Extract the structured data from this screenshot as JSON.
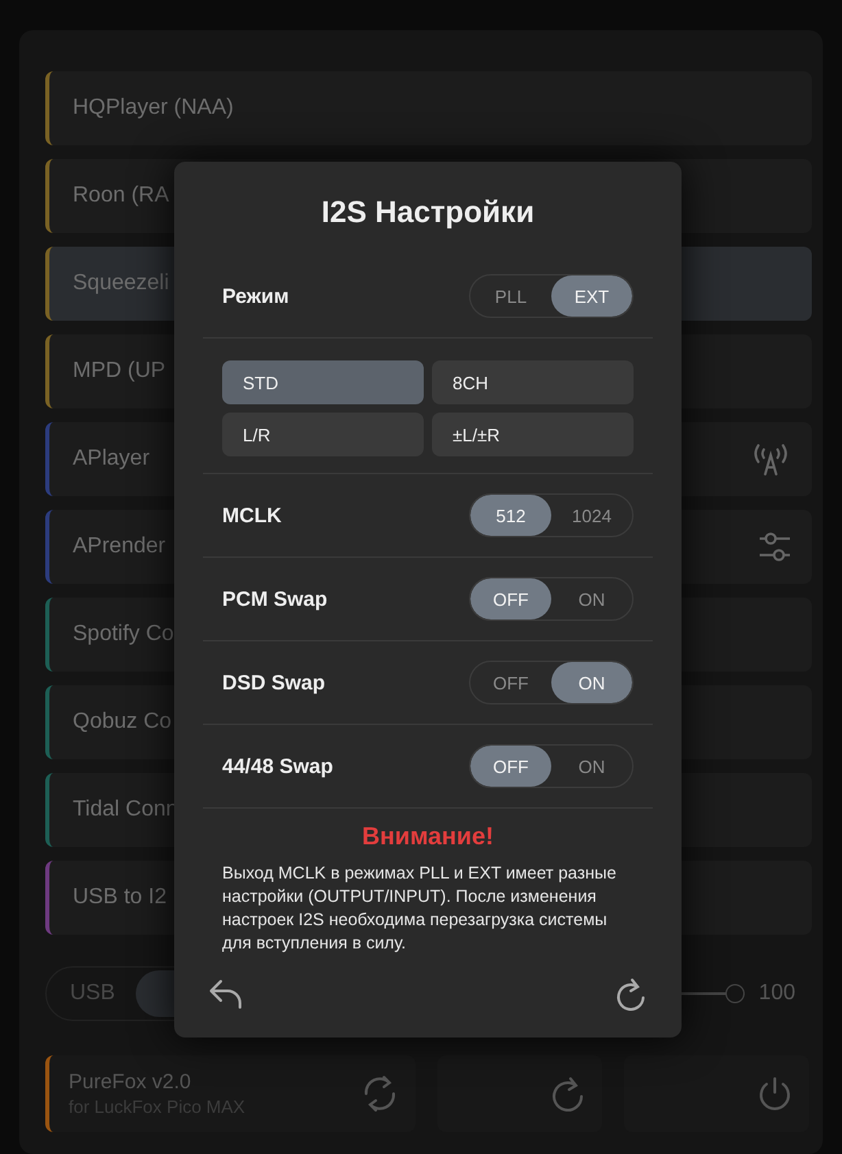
{
  "services": [
    {
      "name": "HQPlayer (NAA)",
      "color": "#7a6224",
      "selected": false,
      "kind": "plain"
    },
    {
      "name": "Roon (RA",
      "color": "#7a6224",
      "selected": false,
      "kind": "plain"
    },
    {
      "name": "Squeezeli",
      "color": "#7a6224",
      "selected": true,
      "kind": "plain"
    },
    {
      "name": "MPD (UP",
      "color": "#7a6224",
      "selected": false,
      "kind": "plain"
    },
    {
      "name": "APlayer",
      "color": "#2c3c7e",
      "selected": false,
      "kind": "network"
    },
    {
      "name": "APrender",
      "color": "#2c3c7e",
      "selected": false,
      "kind": "settings"
    },
    {
      "name": "Spotify Co",
      "color": "#1d5f55",
      "selected": false,
      "kind": "plain"
    },
    {
      "name": "Qobuz Co",
      "color": "#1d5f55",
      "selected": false,
      "kind": "plain"
    },
    {
      "name": "Tidal Conn",
      "color": "#1d5f55",
      "selected": false,
      "kind": "plain"
    },
    {
      "name": "USB to I2",
      "color": "#6e3a80",
      "selected": false,
      "kind": "plain"
    }
  ],
  "output": {
    "options": [
      {
        "label": "USB",
        "selected": false
      }
    ],
    "volume": {
      "level": 1,
      "reading": "100"
    }
  },
  "device": {
    "name": "PureFox v2.0",
    "subtitle": "for LuckFox Pico MAX",
    "color": "#9a5410"
  },
  "dialog": {
    "title": "I2S Настройки",
    "mode": {
      "label": "Режим",
      "options": [
        {
          "label": "PLL",
          "selected": false
        },
        {
          "label": "EXT",
          "selected": true
        }
      ]
    },
    "formats": [
      {
        "label": "STD",
        "selected": true
      },
      {
        "label": "8CH",
        "selected": false
      },
      {
        "label": "L/R",
        "selected": false
      },
      {
        "label": "±L/±R",
        "selected": false
      }
    ],
    "settings": [
      {
        "label": "MCLK",
        "options": [
          {
            "label": "512",
            "selected": true
          },
          {
            "label": "1024",
            "selected": false
          }
        ]
      },
      {
        "label": "PCM Swap",
        "options": [
          {
            "label": "OFF",
            "selected": true
          },
          {
            "label": "ON",
            "selected": false
          }
        ]
      },
      {
        "label": "DSD Swap",
        "options": [
          {
            "label": "OFF",
            "selected": false
          },
          {
            "label": "ON",
            "selected": true
          }
        ]
      },
      {
        "label": "44/48 Swap",
        "options": [
          {
            "label": "OFF",
            "selected": true
          },
          {
            "label": "ON",
            "selected": false
          }
        ]
      }
    ],
    "warning": {
      "title": "Внимание!",
      "text": "Выход MCLK в режимах PLL и EXT имеет разные настройки (OUTPUT/INPUT). После изменения настроек I2S необходима перезагрузка системы для вступления в силу."
    }
  }
}
